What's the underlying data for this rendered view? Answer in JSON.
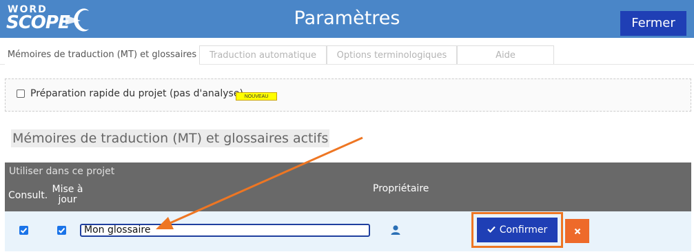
{
  "header": {
    "logo_word": "WORD",
    "logo_scope": "SCOPE",
    "title": "Paramètres",
    "close_label": "Fermer"
  },
  "tabs": [
    {
      "label": "Mémoires de traduction (MT) et glossaires",
      "active": true
    },
    {
      "label": "Traduction automatique",
      "active": false
    },
    {
      "label": "Options terminologiques",
      "active": false
    },
    {
      "label": "Aide",
      "active": false
    }
  ],
  "quick_prep": {
    "label": "Préparation rapide du projet (pas d'analyse)",
    "checked": false,
    "badge": "NOUVEAU"
  },
  "section": {
    "title": "Mémoires de traduction (MT) et glossaires actifs"
  },
  "table": {
    "subheader": "Utiliser dans ce projet",
    "col_consult": "Consult.",
    "col_update": "Mise à jour",
    "col_owner": "Propriétaire",
    "row": {
      "consult_checked": true,
      "update_checked": true,
      "name_value": "Mon glossaire",
      "owner_icon": "user-icon",
      "confirm_label": "Confirmer",
      "confirm_icon": "check-icon",
      "cancel_icon": "close-icon"
    }
  },
  "colors": {
    "header_bg": "#4a86c8",
    "primary_button": "#1f3fb5",
    "accent_orange": "#ee7623",
    "table_header_bg": "#696969",
    "row_bg": "#e9f3fb"
  }
}
